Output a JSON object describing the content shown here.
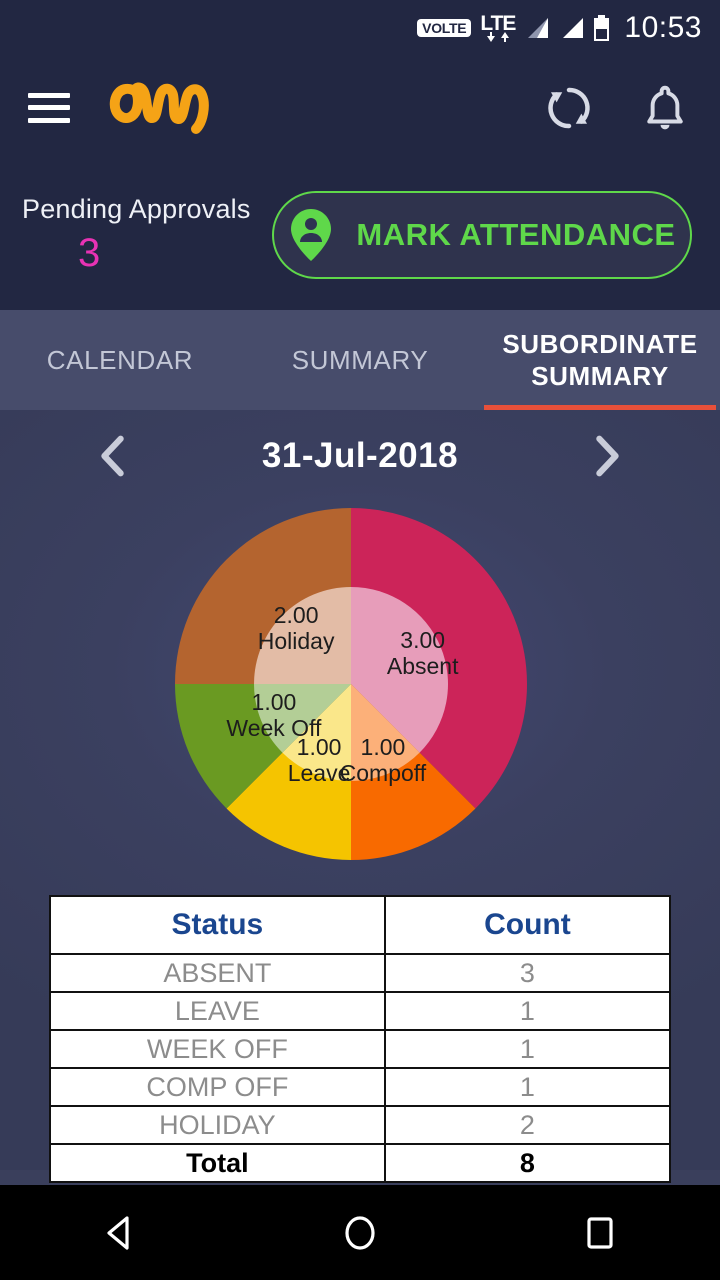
{
  "statusbar": {
    "volte_badge": "VOLTE",
    "network_type": "LTE",
    "clock": "10:53",
    "icons": [
      "volte-badge",
      "lte-indicator",
      "signal-bars-sim1",
      "signal-bars-sim2",
      "battery-icon"
    ]
  },
  "appbar": {
    "menu_icon": "hamburger-menu-icon",
    "logo_alt": "cm-logo",
    "sync_icon": "sync-refresh-icon",
    "notification_icon": "bell-notification-icon"
  },
  "pending": {
    "label": "Pending Approvals",
    "count": "3"
  },
  "mark_attendance": {
    "label": "MARK ATTENDANCE",
    "icon": "location-person-pin-icon",
    "accent": "#5fd84a"
  },
  "tabs": [
    {
      "label": "CALENDAR",
      "active": false
    },
    {
      "label": "SUMMARY",
      "active": false
    },
    {
      "label": "SUBORDINATE SUMMARY",
      "active": true
    }
  ],
  "tab_indicator_color": "#e8503a",
  "datebar": {
    "date": "31-Jul-2018",
    "prev_icon": "chevron-left-icon",
    "next_icon": "chevron-right-icon"
  },
  "chart_data": {
    "type": "pie",
    "title": "",
    "total": 8,
    "legend_position": "on-slice",
    "labels": [
      "Absent",
      "Compoff",
      "Leave",
      "Week Off",
      "Holiday"
    ],
    "values": [
      3.0,
      1.0,
      1.0,
      1.0,
      2.0
    ],
    "value_labels": [
      "3.00",
      "1.00",
      "1.00",
      "1.00",
      "2.00"
    ],
    "colors": [
      "#cc2459",
      "#f86a00",
      "#f5c400",
      "#6a9a22",
      "#b4642f"
    ],
    "inner_colors": [
      "#e79dba",
      "#fcb079",
      "#fae78a",
      "#b3ce96",
      "#e3bca6"
    ],
    "start_angle_deg": 0,
    "direction": "clockwise",
    "slices": [
      {
        "label": "Absent",
        "value": 3.0,
        "value_label": "3.00",
        "start_deg": 0,
        "end_deg": 135,
        "color": "#cc2459",
        "inner_color": "#e79dba"
      },
      {
        "label": "Compoff",
        "value": 1.0,
        "value_label": "1.00",
        "start_deg": 135,
        "end_deg": 180,
        "color": "#f86a00",
        "inner_color": "#fcb079"
      },
      {
        "label": "Leave",
        "value": 1.0,
        "value_label": "1.00",
        "start_deg": 180,
        "end_deg": 225,
        "color": "#f5c400",
        "inner_color": "#fae78a"
      },
      {
        "label": "Week Off",
        "value": 1.0,
        "value_label": "1.00",
        "start_deg": 225,
        "end_deg": 270,
        "color": "#6a9a22",
        "inner_color": "#b3ce96"
      },
      {
        "label": "Holiday",
        "value": 2.0,
        "value_label": "2.00",
        "start_deg": 270,
        "end_deg": 360,
        "color": "#b4642f",
        "inner_color": "#e3bca6"
      }
    ]
  },
  "table": {
    "headers": [
      "Status",
      "Count"
    ],
    "rows": [
      [
        "ABSENT",
        "3"
      ],
      [
        "LEAVE",
        "1"
      ],
      [
        "WEEK OFF",
        "1"
      ],
      [
        "COMP OFF",
        "1"
      ],
      [
        "HOLIDAY",
        "2"
      ]
    ],
    "total_row": [
      "Total",
      "8"
    ],
    "header_color": "#1a468f"
  },
  "navbar": {
    "back_icon": "back-triangle-icon",
    "home_icon": "home-circle-icon",
    "recents_icon": "recents-square-icon"
  }
}
